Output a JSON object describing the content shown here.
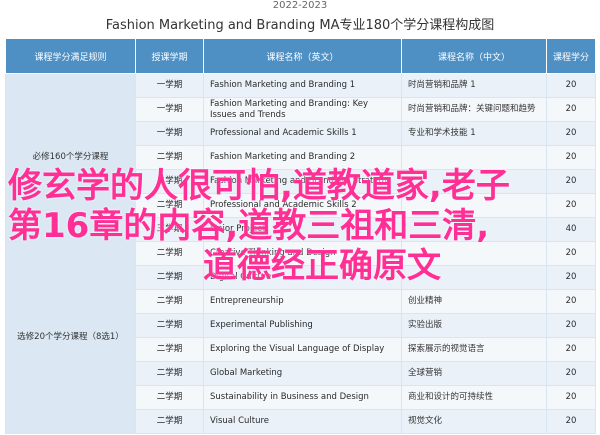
{
  "header": {
    "subtitle": "2022-2023",
    "title": "Fashion Marketing and Branding MA专业180个学分课程构成图"
  },
  "table": {
    "headers": [
      "课程学分满足规则",
      "授课学期",
      "课程名称（英文）",
      "课程名称（中文）",
      "课程学分"
    ],
    "blocks": [
      "必修160个学分课程",
      "选修20个学分课程（8选1）"
    ],
    "rows": [
      {
        "sem": "一学期",
        "en": "Fashion Marketing and Branding 1",
        "cn": "时尚营销和品牌 1",
        "cr": "20"
      },
      {
        "sem": "一学期",
        "en": "Fashion Marketing and Branding: Key Issues and Trends",
        "cn": "时尚营销和品牌：关键问题和趋势",
        "cr": "20"
      },
      {
        "sem": "一学期",
        "en": "Professional and Academic Skills 1",
        "cn": "专业和学术技能 1",
        "cr": "20"
      },
      {
        "sem": "二学期",
        "en": "Fashion Marketing and Branding 2",
        "cn": "",
        "cr": "20"
      },
      {
        "sem": "二学期",
        "en": "Fashion Marketing and Branding: Strategy",
        "cn": "",
        "cr": "20"
      },
      {
        "sem": "二学期",
        "en": "Professional and Academic Skills 2",
        "cn": "",
        "cr": "20"
      },
      {
        "sem": "三学期",
        "en": "Major Project",
        "cn": "",
        "cr": "40"
      },
      {
        "sem": "二学期",
        "en": "Creative Thinking and Design",
        "cn": "",
        "cr": "20"
      },
      {
        "sem": "二学期",
        "en": "Digital Culture",
        "cn": "",
        "cr": "20"
      },
      {
        "sem": "二学期",
        "en": "Entrepreneurship",
        "cn": "创业精神",
        "cr": "20"
      },
      {
        "sem": "二学期",
        "en": "Experimental Publishing",
        "cn": "实验出版",
        "cr": "20"
      },
      {
        "sem": "二学期",
        "en": "Exploring the Visual Language of Display",
        "cn": "探索展示的视觉语言",
        "cr": "20"
      },
      {
        "sem": "二学期",
        "en": "Global Marketing",
        "cn": "全球营销",
        "cr": "20"
      },
      {
        "sem": "二学期",
        "en": "Sustainability in Business and Design",
        "cn": "商业和设计的可持续性",
        "cr": "20"
      },
      {
        "sem": "二学期",
        "en": "Visual Culture",
        "cn": "视觉文化",
        "cr": "20"
      }
    ]
  },
  "overlay": {
    "line1": "修玄学的人很可怕,道教道家,老子",
    "line2": "第16章的内容,道教三祖和三清,",
    "line3": "道德经正确原文",
    "color": "#ff2f95"
  },
  "colors": {
    "header_bg": "#4e8fc4",
    "block_bg": "#dbe8f4"
  }
}
